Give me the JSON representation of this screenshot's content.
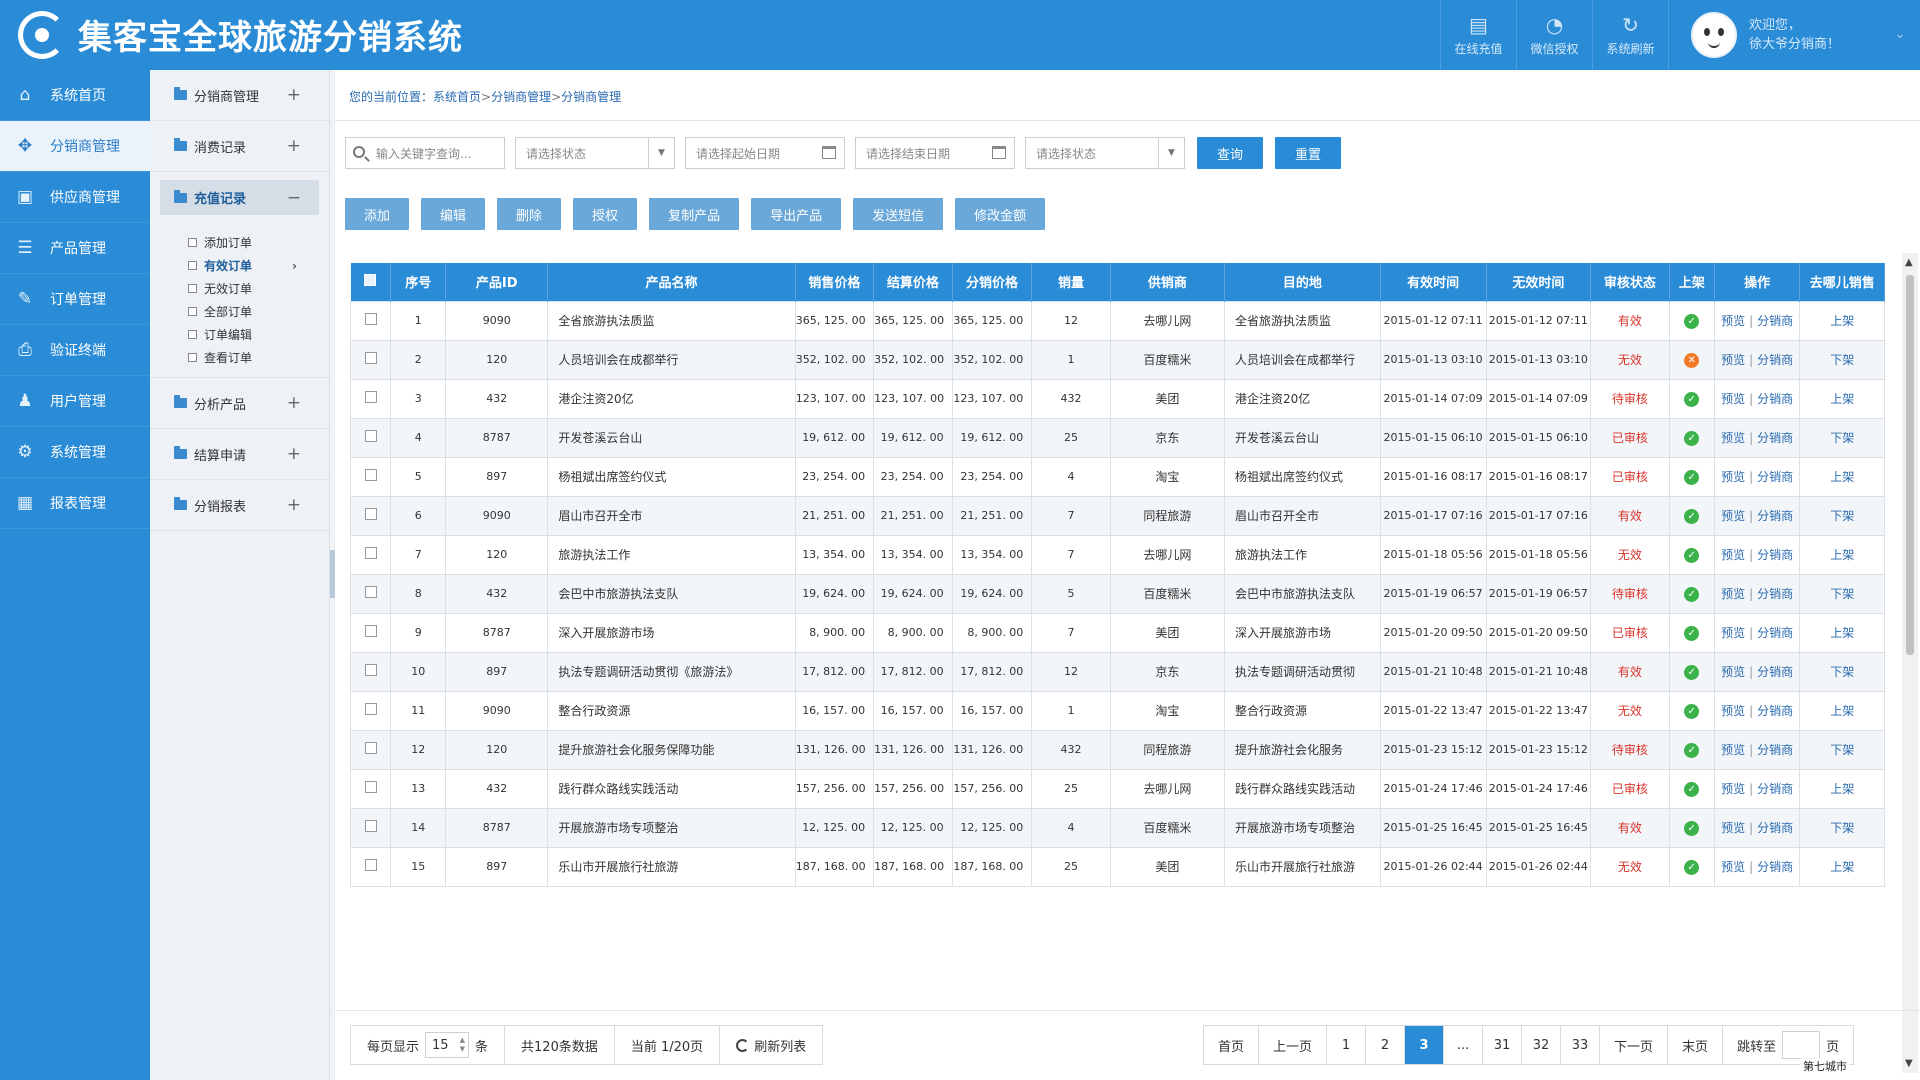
{
  "app": {
    "title": "集客宝全球旅游分销系统"
  },
  "header": {
    "tools": [
      {
        "icon": "recharge-icon",
        "glyph": "▤",
        "label": "在线充值"
      },
      {
        "icon": "wechat-icon",
        "glyph": "◔",
        "label": "微信授权"
      },
      {
        "icon": "refresh-icon",
        "glyph": "↻",
        "label": "系统刷新"
      }
    ],
    "welcome_line1": "欢迎您，",
    "welcome_line2": "徐大爷分销商！"
  },
  "mainnav": [
    {
      "id": "home",
      "glyph": "⌂",
      "label": "系统首页"
    },
    {
      "id": "distributor",
      "glyph": "✥",
      "label": "分销商管理",
      "active": true
    },
    {
      "id": "supplier",
      "glyph": "▣",
      "label": "供应商管理"
    },
    {
      "id": "product",
      "glyph": "☰",
      "label": "产品管理"
    },
    {
      "id": "order",
      "glyph": "✎",
      "label": "订单管理"
    },
    {
      "id": "verify",
      "glyph": "⎙",
      "label": "验证终端"
    },
    {
      "id": "user",
      "glyph": "♟",
      "label": "用户管理"
    },
    {
      "id": "system",
      "glyph": "⚙",
      "label": "系统管理"
    },
    {
      "id": "report",
      "glyph": "▦",
      "label": "报表管理"
    }
  ],
  "subnav": {
    "items_top": [
      {
        "label": "分销商管理",
        "pm": "+"
      },
      {
        "label": "消费记录",
        "pm": "+"
      }
    ],
    "open_item": {
      "label": "充值记录",
      "pm": "−"
    },
    "leaves": [
      {
        "label": "添加订单"
      },
      {
        "label": "有效订单",
        "active": true,
        "arrow": "›"
      },
      {
        "label": "无效订单"
      },
      {
        "label": "全部订单"
      },
      {
        "label": "订单编辑"
      },
      {
        "label": "查看订单"
      }
    ],
    "items_bottom": [
      {
        "label": "分析产品",
        "pm": "+"
      },
      {
        "label": "结算申请",
        "pm": "+"
      },
      {
        "label": "分销报表",
        "pm": "+"
      }
    ]
  },
  "breadcrumb": {
    "prefix": "您的当前位置：",
    "items": [
      "系统首页",
      "分销商管理",
      "分销商管理"
    ],
    "sep": ">"
  },
  "filters": {
    "search_placeholder": "输入关键字查询...",
    "status1_placeholder": "请选择状态",
    "start_date_placeholder": "请选择起始日期",
    "end_date_placeholder": "请选择结束日期",
    "status2_placeholder": "请选择状态",
    "query_label": "查询",
    "reset_label": "重置"
  },
  "actions": [
    "添加",
    "编辑",
    "删除",
    "授权",
    "复制产品",
    "导出产品",
    "发送短信",
    "修改金额"
  ],
  "table": {
    "headers": [
      "序号",
      "产品ID",
      "产品名称",
      "销售价格",
      "结算价格",
      "分销价格",
      "销量",
      "供销商",
      "目的地",
      "有效时间",
      "无效时间",
      "审核状态",
      "上架",
      "操作",
      "去哪儿销售"
    ],
    "link_preview": "预览",
    "link_distributor": "分销商",
    "link_sep": "|",
    "rows": [
      {
        "no": "1",
        "pid": "9090",
        "name": "全省旅游执法质监",
        "sale": "365, 125. 00",
        "settle": "365, 125. 00",
        "dist": "365, 125. 00",
        "qty": "12",
        "supplier": "去哪儿网",
        "dest": "全省旅游执法质监",
        "valid": "2015-01-12 07:11",
        "invalid": "2015-01-12 07:11",
        "status": "有效",
        "shelf": "ok",
        "sell": "上架"
      },
      {
        "no": "2",
        "pid": "120",
        "name": "人员培训会在成都举行",
        "sale": "352, 102. 00",
        "settle": "352, 102. 00",
        "dist": "352, 102. 00",
        "qty": "1",
        "supplier": "百度糯米",
        "dest": "人员培训会在成都举行",
        "valid": "2015-01-13 03:10",
        "invalid": "2015-01-13 03:10",
        "status": "无效",
        "shelf": "no",
        "sell": "下架"
      },
      {
        "no": "3",
        "pid": "432",
        "name": "港企注资20亿",
        "sale": "123, 107. 00",
        "settle": "123, 107. 00",
        "dist": "123, 107. 00",
        "qty": "432",
        "supplier": "美团",
        "dest": "港企注资20亿",
        "valid": "2015-01-14 07:09",
        "invalid": "2015-01-14 07:09",
        "status": "待审核",
        "shelf": "ok",
        "sell": "上架"
      },
      {
        "no": "4",
        "pid": "8787",
        "name": "开发苍溪云台山",
        "sale": "19, 612. 00",
        "settle": "19, 612. 00",
        "dist": "19, 612. 00",
        "qty": "25",
        "supplier": "京东",
        "dest": "开发苍溪云台山",
        "valid": "2015-01-15 06:10",
        "invalid": "2015-01-15 06:10",
        "status": "已审核",
        "shelf": "ok",
        "sell": "下架"
      },
      {
        "no": "5",
        "pid": "897",
        "name": "杨祖斌出席签约仪式",
        "sale": "23, 254. 00",
        "settle": "23, 254. 00",
        "dist": "23, 254. 00",
        "qty": "4",
        "supplier": "淘宝",
        "dest": "杨祖斌出席签约仪式",
        "valid": "2015-01-16 08:17",
        "invalid": "2015-01-16 08:17",
        "status": "已审核",
        "shelf": "ok",
        "sell": "上架"
      },
      {
        "no": "6",
        "pid": "9090",
        "name": "眉山市召开全市",
        "sale": "21, 251. 00",
        "settle": "21, 251. 00",
        "dist": "21, 251. 00",
        "qty": "7",
        "supplier": "同程旅游",
        "dest": "眉山市召开全市",
        "valid": "2015-01-17 07:16",
        "invalid": "2015-01-17 07:16",
        "status": "有效",
        "shelf": "ok",
        "sell": "下架"
      },
      {
        "no": "7",
        "pid": "120",
        "name": "旅游执法工作",
        "sale": "13, 354. 00",
        "settle": "13, 354. 00",
        "dist": "13, 354. 00",
        "qty": "7",
        "supplier": "去哪儿网",
        "dest": "旅游执法工作",
        "valid": "2015-01-18 05:56",
        "invalid": "2015-01-18 05:56",
        "status": "无效",
        "shelf": "ok",
        "sell": "上架"
      },
      {
        "no": "8",
        "pid": "432",
        "name": "会巴中市旅游执法支队",
        "sale": "19, 624. 00",
        "settle": "19, 624. 00",
        "dist": "19, 624. 00",
        "qty": "5",
        "supplier": "百度糯米",
        "dest": "会巴中市旅游执法支队",
        "valid": "2015-01-19 06:57",
        "invalid": "2015-01-19 06:57",
        "status": "待审核",
        "shelf": "ok",
        "sell": "下架"
      },
      {
        "no": "9",
        "pid": "8787",
        "name": "深入开展旅游市场",
        "sale": "8, 900. 00",
        "settle": "8, 900. 00",
        "dist": "8, 900. 00",
        "qty": "7",
        "supplier": "美团",
        "dest": "深入开展旅游市场",
        "valid": "2015-01-20 09:50",
        "invalid": "2015-01-20 09:50",
        "status": "已审核",
        "shelf": "ok",
        "sell": "上架"
      },
      {
        "no": "10",
        "pid": "897",
        "name": "执法专题调研活动贯彻《旅游法》",
        "sale": "17, 812. 00",
        "settle": "17, 812. 00",
        "dist": "17, 812. 00",
        "qty": "12",
        "supplier": "京东",
        "dest": "执法专题调研活动贯彻",
        "valid": "2015-01-21 10:48",
        "invalid": "2015-01-21 10:48",
        "status": "有效",
        "shelf": "ok",
        "sell": "下架"
      },
      {
        "no": "11",
        "pid": "9090",
        "name": "整合行政资源",
        "sale": "16, 157. 00",
        "settle": "16, 157. 00",
        "dist": "16, 157. 00",
        "qty": "1",
        "supplier": "淘宝",
        "dest": "整合行政资源",
        "valid": "2015-01-22 13:47",
        "invalid": "2015-01-22 13:47",
        "status": "无效",
        "shelf": "ok",
        "sell": "上架"
      },
      {
        "no": "12",
        "pid": "120",
        "name": "提升旅游社会化服务保障功能",
        "sale": "131, 126. 00",
        "settle": "131, 126. 00",
        "dist": "131, 126. 00",
        "qty": "432",
        "supplier": "同程旅游",
        "dest": "提升旅游社会化服务",
        "valid": "2015-01-23 15:12",
        "invalid": "2015-01-23 15:12",
        "status": "待审核",
        "shelf": "ok",
        "sell": "下架"
      },
      {
        "no": "13",
        "pid": "432",
        "name": "践行群众路线实践活动",
        "sale": "157, 256. 00",
        "settle": "157, 256. 00",
        "dist": "157, 256. 00",
        "qty": "25",
        "supplier": "去哪儿网",
        "dest": "践行群众路线实践活动",
        "valid": "2015-01-24 17:46",
        "invalid": "2015-01-24 17:46",
        "status": "已审核",
        "shelf": "ok",
        "sell": "上架"
      },
      {
        "no": "14",
        "pid": "8787",
        "name": "开展旅游市场专项整治",
        "sale": "12, 125. 00",
        "settle": "12, 125. 00",
        "dist": "12, 125. 00",
        "qty": "4",
        "supplier": "百度糯米",
        "dest": "开展旅游市场专项整治",
        "valid": "2015-01-25 16:45",
        "invalid": "2015-01-25 16:45",
        "status": "有效",
        "shelf": "ok",
        "sell": "下架"
      },
      {
        "no": "15",
        "pid": "897",
        "name": "乐山市开展旅行社旅游",
        "sale": "187, 168. 00",
        "settle": "187, 168. 00",
        "dist": "187, 168. 00",
        "qty": "25",
        "supplier": "美团",
        "dest": "乐山市开展旅行社旅游",
        "valid": "2015-01-26 02:44",
        "invalid": "2015-01-26 02:44",
        "status": "无效",
        "shelf": "ok",
        "sell": "上架"
      }
    ]
  },
  "pager": {
    "per_page_prefix": "每页显示",
    "per_page_value": "15",
    "per_page_suffix": "条",
    "total": "共120条数据",
    "current": "当前 1/20页",
    "refresh": "刷新列表",
    "first": "首页",
    "prev": "上一页",
    "pages": [
      "1",
      "2",
      "3",
      "...",
      "31",
      "32",
      "33"
    ],
    "current_page": "3",
    "next": "下一页",
    "last": "末页",
    "jump_prefix": "跳转至",
    "jump_suffix": "页"
  },
  "watermark": "第七城市",
  "colors": {
    "primary": "#2a8bd6",
    "action": "#6aa8da",
    "status_red": "#d9342b",
    "ok_green": "#3cb34a",
    "no_orange": "#f07a2a"
  }
}
